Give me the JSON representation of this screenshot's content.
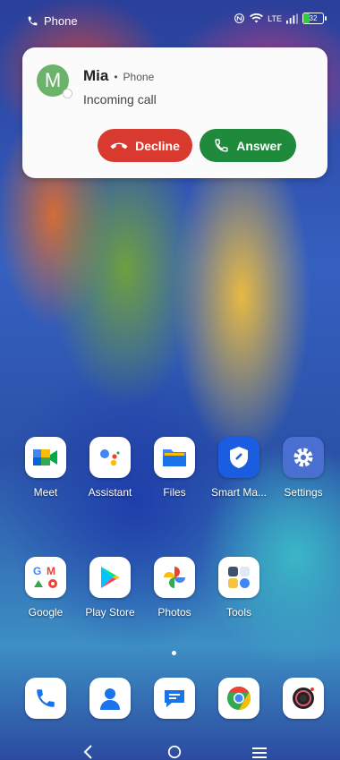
{
  "status_bar": {
    "app_label": "Phone",
    "network": "LTE",
    "battery_level": "32"
  },
  "notification": {
    "avatar_letter": "M",
    "caller_name": "Mia",
    "source_app": "Phone",
    "status": "Incoming call",
    "decline_label": "Decline",
    "answer_label": "Answer",
    "colors": {
      "decline": "#d93a2f",
      "answer": "#1f8a3c",
      "avatar": "#6bb26b"
    }
  },
  "home": {
    "row1": [
      {
        "label": "Meet",
        "icon": "google-meet-icon"
      },
      {
        "label": "Assistant",
        "icon": "google-assistant-icon"
      },
      {
        "label": "Files",
        "icon": "files-icon"
      },
      {
        "label": "Smart Ma...",
        "icon": "smart-manager-icon"
      },
      {
        "label": "Settings",
        "icon": "settings-gear-icon"
      }
    ],
    "row2": [
      {
        "label": "Google",
        "icon": "google-folder-icon"
      },
      {
        "label": "Play Store",
        "icon": "play-store-icon"
      },
      {
        "label": "Photos",
        "icon": "photos-pinwheel-icon"
      },
      {
        "label": "Tools",
        "icon": "tools-folder-icon"
      }
    ],
    "dock": [
      {
        "icon": "phone-icon"
      },
      {
        "icon": "contacts-icon"
      },
      {
        "icon": "messages-icon"
      },
      {
        "icon": "chrome-icon"
      },
      {
        "icon": "camera-icon"
      }
    ]
  }
}
